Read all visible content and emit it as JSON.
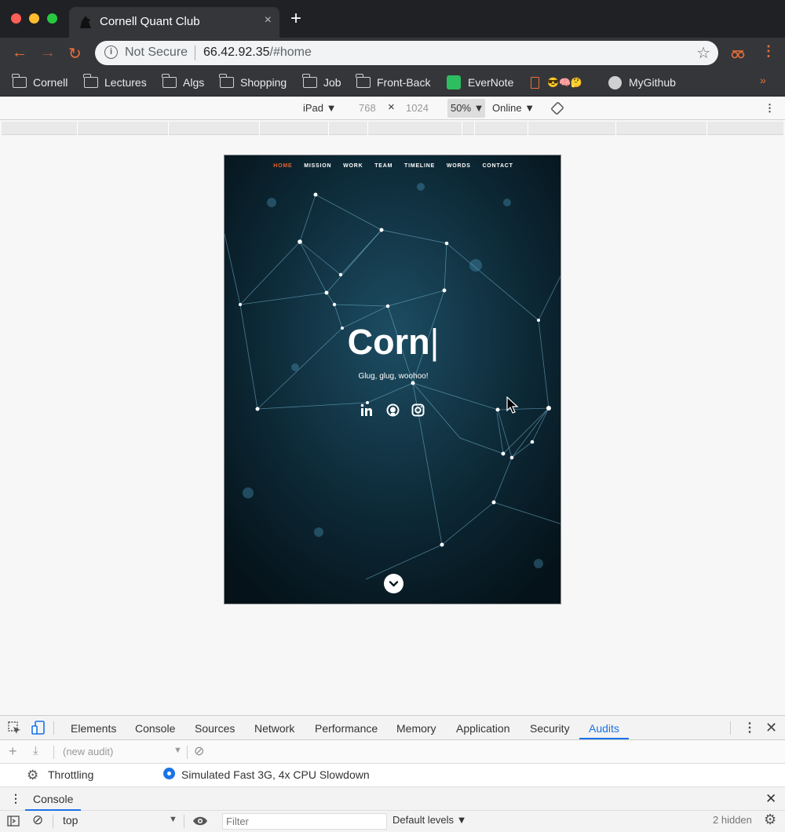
{
  "browser": {
    "tab_title": "Cornell Quant Club",
    "tab_close": "×",
    "new_tab": "+",
    "url_security": "Not Secure",
    "url_host": "66.42.92.35",
    "url_path": "/#home",
    "accent_color": "#e8703a",
    "bookmarks": [
      {
        "label": "Cornell",
        "icon": "folder-icon"
      },
      {
        "label": "Lectures",
        "icon": "folder-icon"
      },
      {
        "label": "Algs",
        "icon": "folder-icon"
      },
      {
        "label": "Shopping",
        "icon": "folder-icon"
      },
      {
        "label": "Job",
        "icon": "folder-icon"
      },
      {
        "label": "Front-Back",
        "icon": "folder-icon"
      },
      {
        "label": "EverNote",
        "icon": "evernote-icon"
      },
      {
        "label": "😎🧠🤔",
        "icon": "page-icon"
      },
      {
        "label": "MyGithub",
        "icon": "github-icon"
      }
    ],
    "bookmarks_more": "»"
  },
  "device_toolbar": {
    "device": "iPad ▼",
    "width": "768",
    "times": "×",
    "height": "1024",
    "zoom": "50% ▼",
    "network": "Online ▼"
  },
  "site": {
    "nav": [
      "HOME",
      "MISSION",
      "WORK",
      "TEAM",
      "TIMELINE",
      "WORDS",
      "CONTACT"
    ],
    "title": "Corn",
    "caret": "|",
    "tagline": "Glug, glug, woohoo!",
    "active_color": "#e5612b"
  },
  "devtools": {
    "tabs": [
      "Elements",
      "Console",
      "Sources",
      "Network",
      "Performance",
      "Memory",
      "Application",
      "Security",
      "Audits"
    ],
    "active_tab": "Audits",
    "new_audit": "(new audit)",
    "throttling_label": "Throttling",
    "throttling_value": "Simulated Fast 3G, 4x CPU Slowdown",
    "drawer_tab": "Console",
    "context": "top",
    "filter_placeholder": "Filter",
    "levels": "Default levels ▼",
    "hidden_count": "2 hidden"
  }
}
